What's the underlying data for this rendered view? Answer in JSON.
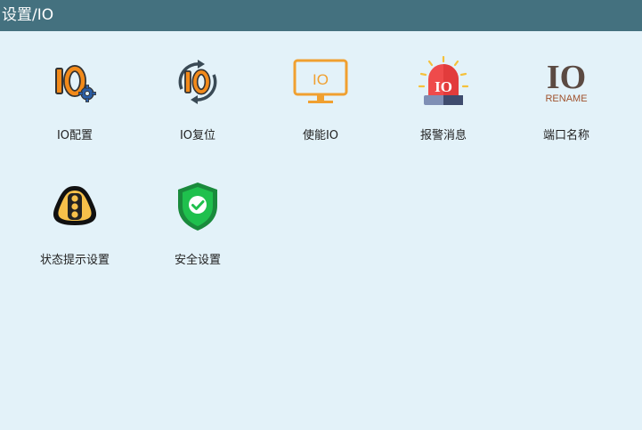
{
  "header": {
    "title": "设置/IO"
  },
  "tiles": [
    {
      "label": "IO配置",
      "icon": "io-gear-icon"
    },
    {
      "label": "IO复位",
      "icon": "io-reset-icon"
    },
    {
      "label": "使能IO",
      "icon": "io-monitor-icon"
    },
    {
      "label": "报警消息",
      "icon": "io-alarm-light-icon"
    },
    {
      "label": "端口名称",
      "icon": "io-rename-icon"
    },
    {
      "label": "状态提示设置",
      "icon": "traffic-light-icon"
    },
    {
      "label": "安全设置",
      "icon": "security-shield-icon"
    }
  ],
  "icon_text": {
    "io": "IO",
    "rename": "RENAME"
  },
  "colors": {
    "header_bg": "#44717f",
    "page_bg": "#e3f2f9",
    "io_orange": "#f28a1a",
    "alarm_red": "#ef4b4b",
    "shield_green": "#1fc04d"
  }
}
